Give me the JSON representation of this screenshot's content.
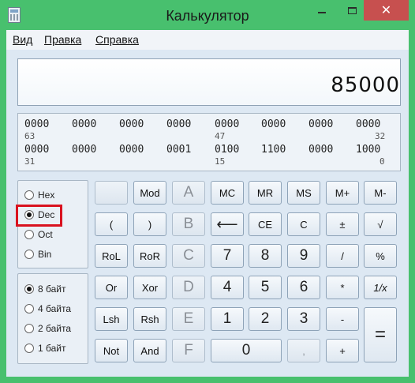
{
  "window": {
    "title": "Калькулятор",
    "close_symbol": "✕"
  },
  "menu": [
    {
      "label": "Вид"
    },
    {
      "label": "Правка"
    },
    {
      "label": "Справка"
    }
  ],
  "display": {
    "value": "85000"
  },
  "bits": {
    "row1": [
      "0000",
      "0000",
      "0000",
      "0000",
      "0000",
      "0000",
      "0000",
      "0000"
    ],
    "row1_positions": [
      "63",
      "47",
      "32"
    ],
    "row2": [
      "0000",
      "0000",
      "0000",
      "0001",
      "0100",
      "1100",
      "0000",
      "1000"
    ],
    "row2_positions": [
      "31",
      "15",
      "0"
    ]
  },
  "number_base": {
    "options": [
      "Hex",
      "Dec",
      "Oct",
      "Bin"
    ],
    "selected": "Dec"
  },
  "word_size": {
    "options": [
      "8 байт",
      "4 байта",
      "2 байта",
      "1 байт"
    ],
    "selected": "8 байт"
  },
  "buttons": {
    "blank": "",
    "mod": "Mod",
    "a": "A",
    "mc": "MC",
    "mr": "MR",
    "ms": "MS",
    "mplus": "M+",
    "mminus": "M-",
    "lparen": "(",
    "rparen": ")",
    "b": "B",
    "backspace": "⟵",
    "ce": "CE",
    "c": "C",
    "plusminus": "±",
    "sqrt": "√",
    "rol": "RoL",
    "ror": "RoR",
    "hex_c": "C",
    "n7": "7",
    "n8": "8",
    "n9": "9",
    "divide": "/",
    "percent": "%",
    "or": "Or",
    "xor": "Xor",
    "d": "D",
    "n4": "4",
    "n5": "5",
    "n6": "6",
    "multiply": "*",
    "reciprocal": "1/x",
    "lsh": "Lsh",
    "rsh": "Rsh",
    "e": "E",
    "n1": "1",
    "n2": "2",
    "n3": "3",
    "minus": "-",
    "equals": "=",
    "not": "Not",
    "and": "And",
    "f": "F",
    "n0": "0",
    "decimal": ",",
    "plus": "+"
  }
}
